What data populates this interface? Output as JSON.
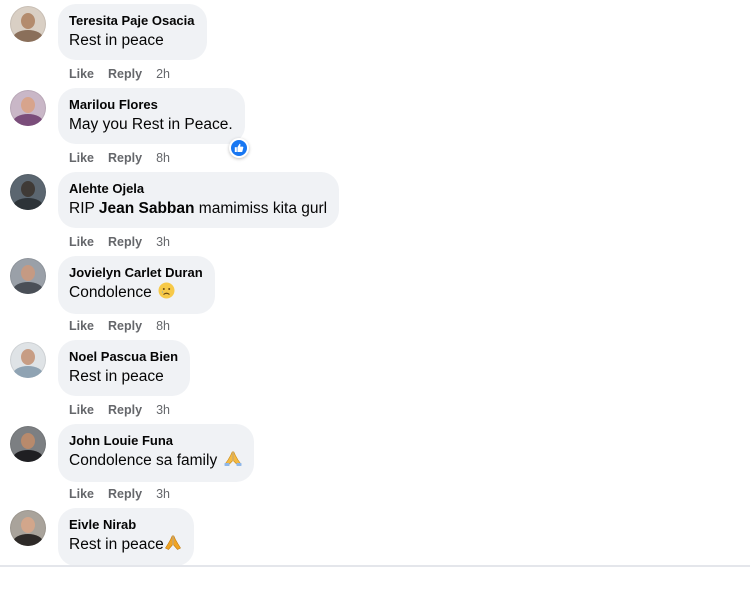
{
  "colors": {
    "bubble_bg": "#f0f2f5",
    "action_text": "#65676b",
    "like_blue": "#1877f2"
  },
  "comments": [
    {
      "author": "Teresita Paje Osacia",
      "text": "Rest in peace",
      "like_label": "Like",
      "reply_label": "Reply",
      "time": "2h",
      "avatar_icon": "user-avatar-icon"
    },
    {
      "author": "Marilou Flores",
      "text": "May you Rest in Peace.",
      "like_label": "Like",
      "reply_label": "Reply",
      "time": "8h",
      "avatar_icon": "user-avatar-icon",
      "reaction_icon": "like-reaction-icon"
    },
    {
      "author": "Alehte Ojela",
      "text_prefix": "RIP ",
      "mention": "Jean Sabban",
      "text_suffix": " mamimiss kita gurl",
      "like_label": "Like",
      "reply_label": "Reply",
      "time": "3h",
      "avatar_icon": "user-avatar-icon"
    },
    {
      "author": "Jovielyn Carlet Duran",
      "text": "Condolence",
      "emoji_icon": "crying-face-icon",
      "like_label": "Like",
      "reply_label": "Reply",
      "time": "8h",
      "avatar_icon": "user-avatar-icon"
    },
    {
      "author": "Noel Pascua Bien",
      "text": "Rest in peace",
      "like_label": "Like",
      "reply_label": "Reply",
      "time": "3h",
      "avatar_icon": "user-avatar-icon"
    },
    {
      "author": "John Louie Funa",
      "text": "Condolence sa family",
      "emoji_icon": "praying-hands-icon",
      "like_label": "Like",
      "reply_label": "Reply",
      "time": "3h",
      "avatar_icon": "user-avatar-icon"
    },
    {
      "author": "Eivle Nirab",
      "text": "Rest in peace",
      "emoji_icon": "praying-hands-icon",
      "avatar_icon": "user-avatar-icon"
    }
  ]
}
